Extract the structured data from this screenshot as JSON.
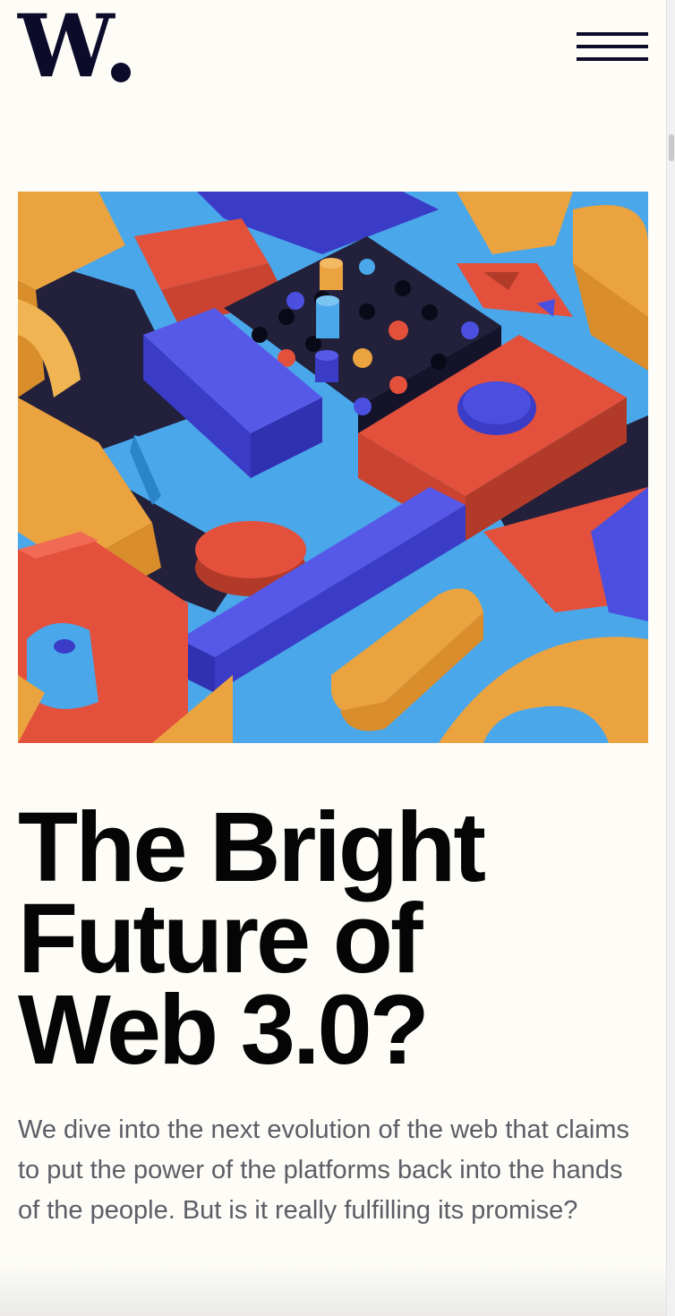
{
  "header": {
    "logo_text": "W",
    "menu_icon": "hamburger-menu-icon"
  },
  "hero": {
    "image_description_icon": "abstract-3d-blocks-illustration"
  },
  "article": {
    "title_lines": [
      "The Bright",
      "Future of",
      "Web 3.0?"
    ],
    "summary": "We dive into the next evolution of the web that claims to put the power of the platforms back into the hands of the people. But is it really fulfilling its promise?"
  },
  "colors": {
    "background": "#fdfcf7",
    "brand_dark": "#0c0b2a",
    "title": "#050505",
    "body_text": "#5d5d66",
    "accent_blue": "#4aa7ea",
    "accent_indigo": "#4b4fe0",
    "accent_red": "#e3503b",
    "accent_orange": "#eba33f",
    "accent_navy": "#22203a"
  }
}
